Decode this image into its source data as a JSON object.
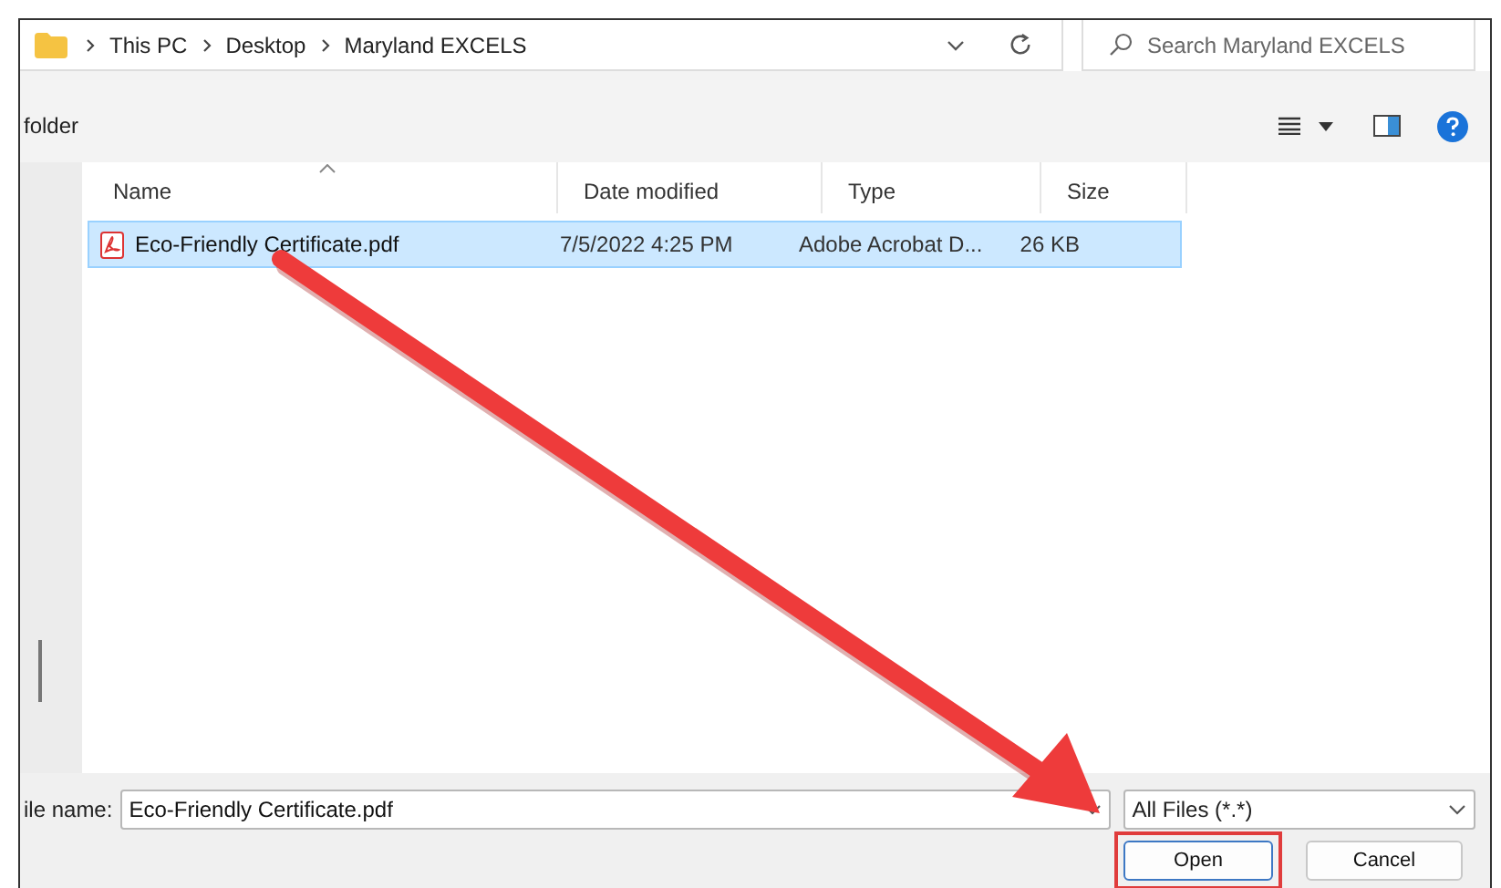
{
  "address_bar": {
    "path": [
      "This PC",
      "Desktop",
      "Maryland EXCELS"
    ]
  },
  "search": {
    "placeholder": "Search Maryland EXCELS"
  },
  "toolbar": {
    "label": "folder"
  },
  "table": {
    "columns": [
      "Name",
      "Date modified",
      "Type",
      "Size"
    ],
    "rows": [
      {
        "name": "Eco-Friendly Certificate.pdf",
        "date": "7/5/2022 4:25 PM",
        "type": "Adobe Acrobat D...",
        "size": "26 KB",
        "selected": true
      }
    ]
  },
  "file_name": {
    "label": "ile name:",
    "value": "Eco-Friendly Certificate.pdf"
  },
  "file_type": {
    "value": "All Files (*.*)"
  },
  "buttons": [
    {
      "label": "Open",
      "highlighted": true
    },
    {
      "label": "Cancel",
      "highlighted": false
    }
  ]
}
